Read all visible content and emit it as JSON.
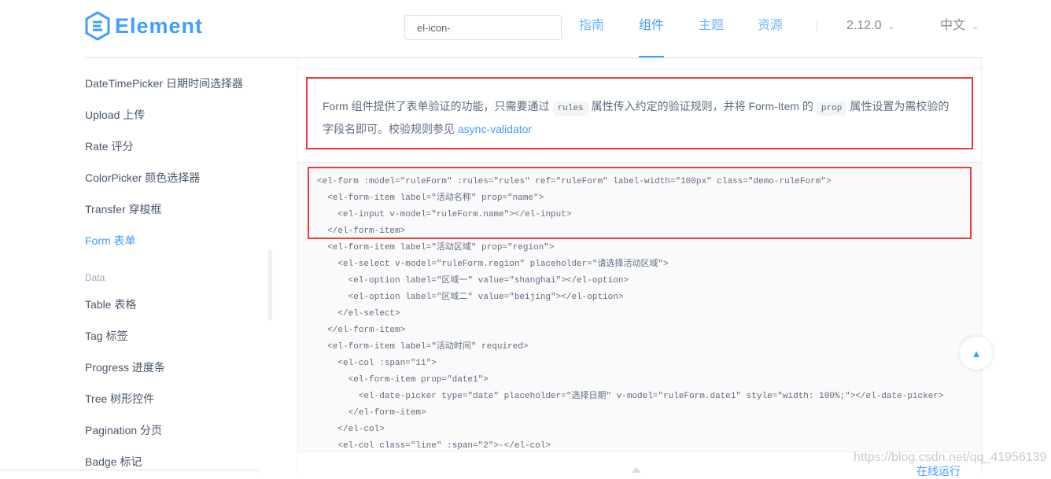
{
  "header": {
    "logo": "Element",
    "search_value": "el-icon-",
    "nav": [
      {
        "label": "指南",
        "active": false
      },
      {
        "label": "组件",
        "active": true
      },
      {
        "label": "主题",
        "active": false
      },
      {
        "label": "资源",
        "active": false
      }
    ],
    "version": "2.12.0",
    "language": "中文"
  },
  "sidebar": {
    "items": [
      "DateTimePicker 日期时间选择器",
      "Upload 上传",
      "Rate 评分",
      "ColorPicker 颜色选择器",
      "Transfer 穿梭框",
      "Form 表单"
    ],
    "active": "Form 表单",
    "group": "Data",
    "group_items": [
      "Table 表格",
      "Tag 标签",
      "Progress 进度条",
      "Tree 树形控件",
      "Pagination 分页",
      "Badge 标记"
    ]
  },
  "content": {
    "desc_1": "Form 组件提供了表单验证的功能，只需要通过",
    "code_rules": "rules",
    "desc_2": "属性传入约定的验证规则，并将 Form-Item 的",
    "code_prop": "prop",
    "desc_3": "属性设置为需校验的字段名即可。校验规则参见",
    "link": "async-validator",
    "code_lines": [
      "<el-form :model=\"ruleForm\" :rules=\"rules\" ref=\"ruleForm\" label-width=\"100px\" class=\"demo-ruleForm\">",
      "  <el-form-item label=\"活动名称\" prop=\"name\">",
      "    <el-input v-model=\"ruleForm.name\"></el-input>",
      "  </el-form-item>",
      "  <el-form-item label=\"活动区域\" prop=\"region\">",
      "    <el-select v-model=\"ruleForm.region\" placeholder=\"请选择活动区域\">",
      "      <el-option label=\"区域一\" value=\"shanghai\"></el-option>",
      "      <el-option label=\"区域二\" value=\"beijing\"></el-option>",
      "    </el-select>",
      "  </el-form-item>",
      "  <el-form-item label=\"活动时间\" required>",
      "    <el-col :span=\"11\">",
      "      <el-form-item prop=\"date1\">",
      "        <el-date-picker type=\"date\" placeholder=\"选择日期\" v-model=\"ruleForm.date1\" style=\"width: 100%;\"></el-date-picker>",
      "      </el-form-item>",
      "    </el-col>",
      "    <el-col class=\"line\" :span=\"2\">-</el-col>"
    ],
    "run_label": "在线运行"
  },
  "watermark": "https://blog.csdn.net/qq_41956139",
  "colors": {
    "accent": "#409eff",
    "highlight_box": "#f03b3b"
  }
}
